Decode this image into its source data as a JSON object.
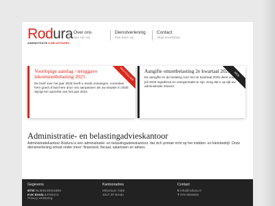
{
  "logo": {
    "word_red": "Rod",
    "word_dark": "ura",
    "tag_dark": "ADMINISTRATIE",
    "tag_red": "& BELASTINGEN"
  },
  "nav": [
    {
      "label": "Over ons",
      "sub": "Wie zijn wij"
    },
    {
      "label": "Dienstverlening",
      "sub": "Wat doen wij"
    },
    {
      "label": "Contact",
      "sub": "Altijd bereikbaar"
    }
  ],
  "cards": [
    {
      "ribbon": "PARTICULIER",
      "title": "Voorlopige aanslag / teruggave inkomstenbelasting 2025",
      "body": "De brief over het jaar 2025 heeft u reeds ontvangen, controleer hem goed of laat hem door ons aanpassen als uw situatie in 2025 wijzigt ten opzichte van het jaar 2024."
    },
    {
      "ribbon": "MKB",
      "title": "Aangifte omzetbelasting 2e kwartaal 2025",
      "body": "De aangifte en de betaling over het 2e kwartaal 2025 dient voor 31 juli 2025 ingediend en overgemaakt te zijn. Zorg dat u op tijd uw administratie inlevert."
    }
  ],
  "main": {
    "heading": "Administratie- en belastingadvieskantoor",
    "intro": "Administratiekantoor Rodura is een administratie- en belastingadvieskantoor, dat zich primair richt op het midden- en kleinbedrijf. Onze dienstverlening omvat onder meer: financieel, fiscaal, salarissen en advies."
  },
  "footer": {
    "gegevens": {
      "title": "Gegevens",
      "btw_label": "BTW",
      "btw_value": "NL805109315B58",
      "kvk_label": "KvK Breda",
      "kvk_value": "54759413",
      "privacy": "Privacy verklaring"
    },
    "kantooradres": {
      "title": "Kantooradres",
      "street": "Mineraum 7458",
      "city": "4817 ZP Breda"
    },
    "contact": {
      "title": "Contact",
      "email_label": "E",
      "email": "info@rodura.nl",
      "phone_label": "T",
      "phone": "076-5654602"
    }
  }
}
